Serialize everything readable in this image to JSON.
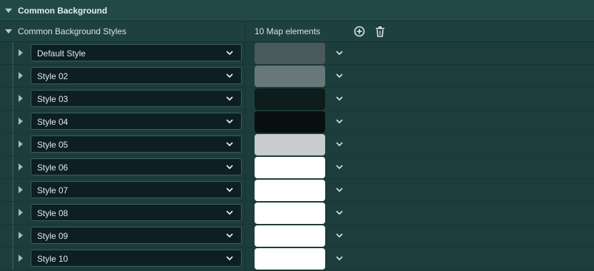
{
  "section": {
    "title": "Common Background"
  },
  "property": {
    "name": "Common Background Styles",
    "count_label": "10 Map elements"
  },
  "icons": {
    "add": "add-circle-icon",
    "delete": "trash-icon"
  },
  "elements": [
    {
      "label": "Default Style",
      "color": "#4a5a5a"
    },
    {
      "label": "Style 02",
      "color": "#687878"
    },
    {
      "label": "Style 03",
      "color": "#0f1c1c"
    },
    {
      "label": "Style 04",
      "color": "#080f0f"
    },
    {
      "label": "Style 05",
      "color": "#c8cccd"
    },
    {
      "label": "Style 06",
      "color": "#ffffff"
    },
    {
      "label": "Style 07",
      "color": "#ffffff"
    },
    {
      "label": "Style 08",
      "color": "#ffffff"
    },
    {
      "label": "Style 09",
      "color": "#ffffff"
    },
    {
      "label": "Style 10",
      "color": "#ffffff"
    }
  ]
}
